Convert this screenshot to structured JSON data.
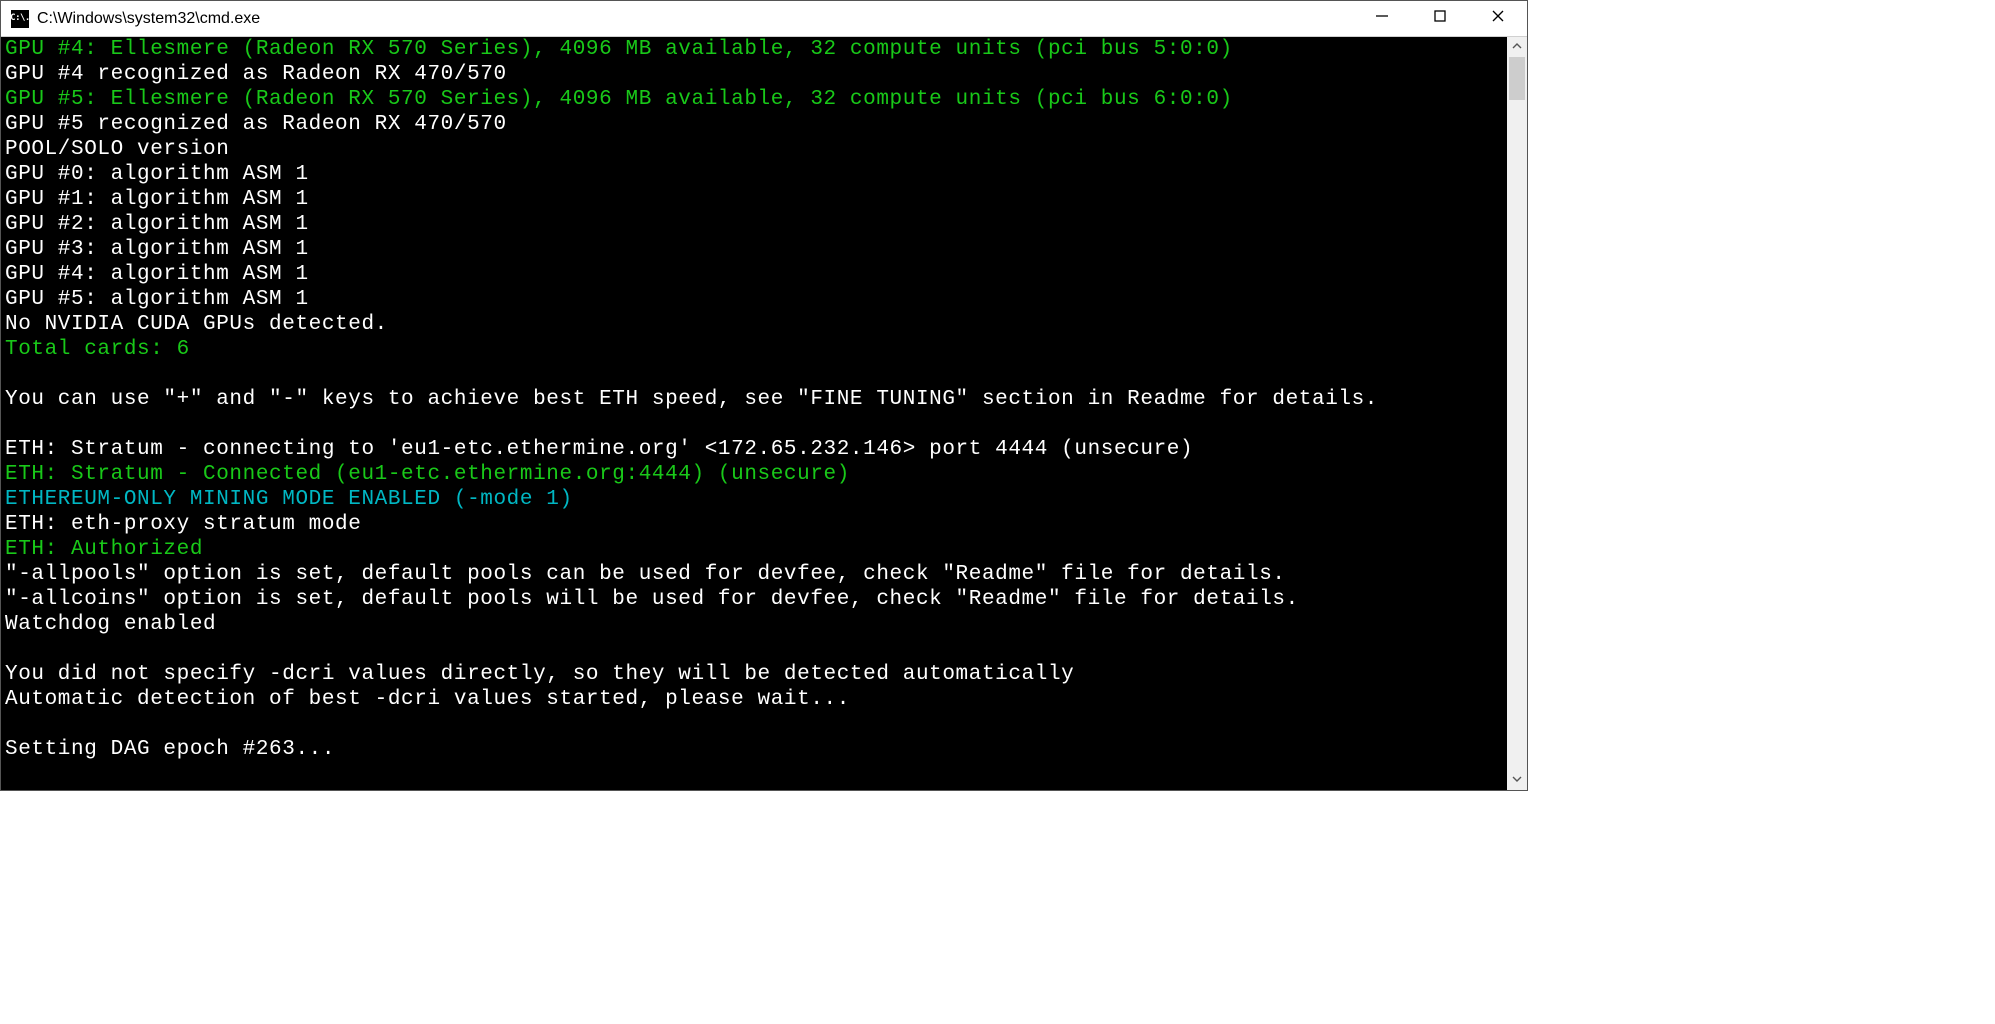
{
  "titlebar": {
    "icon_label": "C:\\.",
    "title": "C:\\Windows\\system32\\cmd.exe"
  },
  "scrollbar": {
    "thumb_top_pct": 0,
    "thumb_height_pct": 6
  },
  "console_lines": [
    {
      "cls": "green",
      "text": "GPU #4: Ellesmere (Radeon RX 570 Series), 4096 MB available, 32 compute units (pci bus 5:0:0)"
    },
    {
      "cls": "",
      "text": "GPU #4 recognized as Radeon RX 470/570"
    },
    {
      "cls": "green",
      "text": "GPU #5: Ellesmere (Radeon RX 570 Series), 4096 MB available, 32 compute units (pci bus 6:0:0)"
    },
    {
      "cls": "",
      "text": "GPU #5 recognized as Radeon RX 470/570"
    },
    {
      "cls": "",
      "text": "POOL/SOLO version"
    },
    {
      "cls": "",
      "text": "GPU #0: algorithm ASM 1"
    },
    {
      "cls": "",
      "text": "GPU #1: algorithm ASM 1"
    },
    {
      "cls": "",
      "text": "GPU #2: algorithm ASM 1"
    },
    {
      "cls": "",
      "text": "GPU #3: algorithm ASM 1"
    },
    {
      "cls": "",
      "text": "GPU #4: algorithm ASM 1"
    },
    {
      "cls": "",
      "text": "GPU #5: algorithm ASM 1"
    },
    {
      "cls": "",
      "text": "No NVIDIA CUDA GPUs detected."
    },
    {
      "cls": "green",
      "text": "Total cards: 6"
    },
    {
      "cls": "",
      "text": ""
    },
    {
      "cls": "",
      "text": "You can use \"+\" and \"-\" keys to achieve best ETH speed, see \"FINE TUNING\" section in Readme for details."
    },
    {
      "cls": "",
      "text": ""
    },
    {
      "cls": "",
      "text": "ETH: Stratum - connecting to 'eu1-etc.ethermine.org' <172.65.232.146> port 4444 (unsecure)"
    },
    {
      "cls": "green",
      "text": "ETH: Stratum - Connected (eu1-etc.ethermine.org:4444) (unsecure)"
    },
    {
      "cls": "cyan",
      "text": "ETHEREUM-ONLY MINING MODE ENABLED (-mode 1)"
    },
    {
      "cls": "",
      "text": "ETH: eth-proxy stratum mode"
    },
    {
      "cls": "green",
      "text": "ETH: Authorized"
    },
    {
      "cls": "",
      "text": "\"-allpools\" option is set, default pools can be used for devfee, check \"Readme\" file for details."
    },
    {
      "cls": "",
      "text": "\"-allcoins\" option is set, default pools will be used for devfee, check \"Readme\" file for details."
    },
    {
      "cls": "",
      "text": "Watchdog enabled"
    },
    {
      "cls": "",
      "text": ""
    },
    {
      "cls": "",
      "text": "You did not specify -dcri values directly, so they will be detected automatically"
    },
    {
      "cls": "",
      "text": "Automatic detection of best -dcri values started, please wait..."
    },
    {
      "cls": "",
      "text": ""
    },
    {
      "cls": "",
      "text": "Setting DAG epoch #263..."
    }
  ]
}
